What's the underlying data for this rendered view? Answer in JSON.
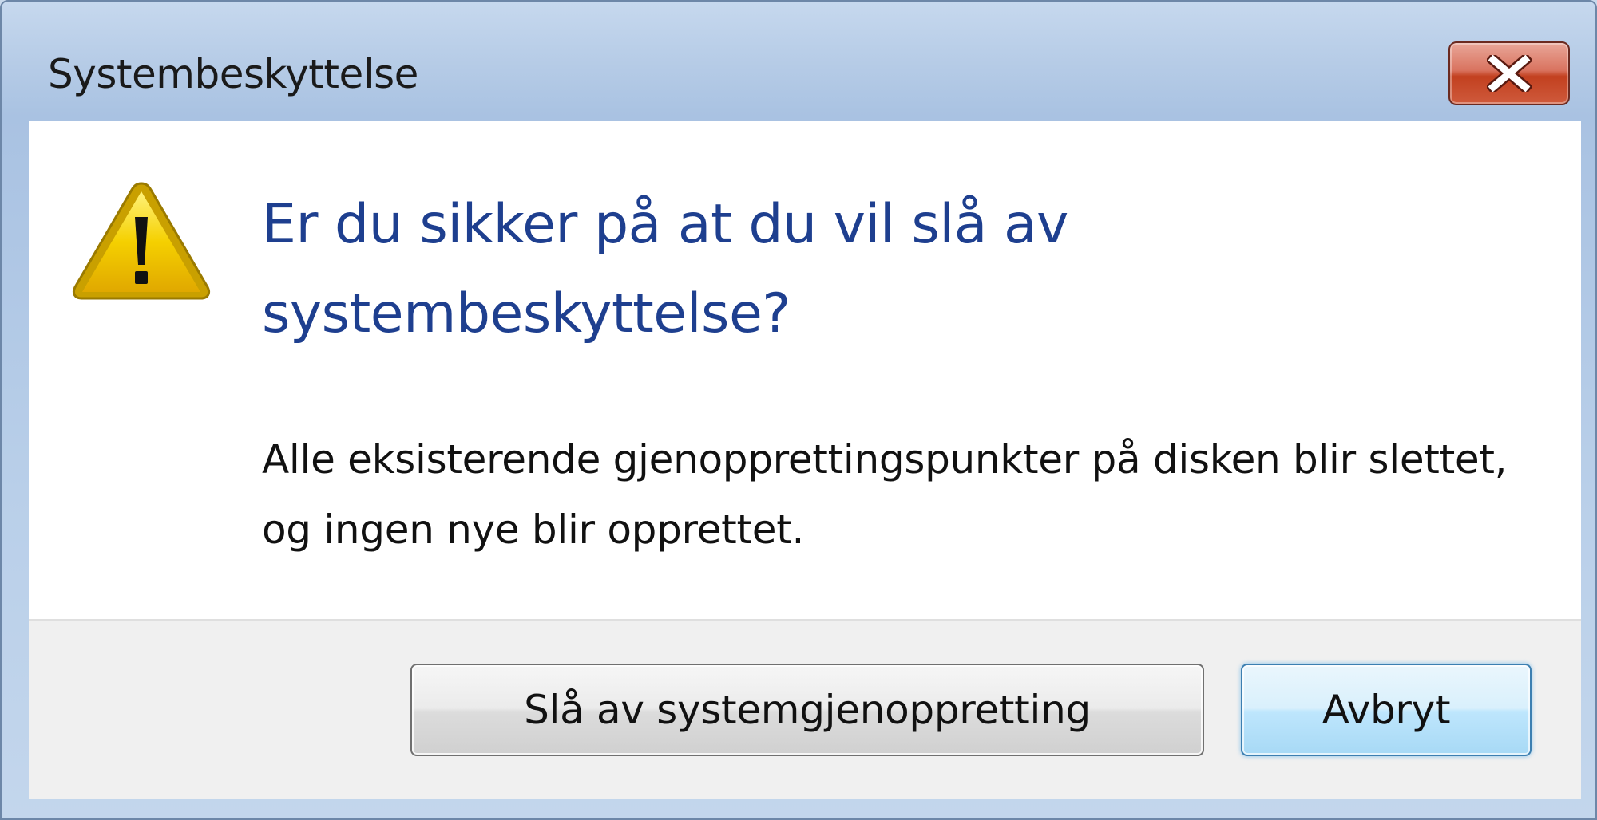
{
  "window": {
    "title": "Systembeskyttelse"
  },
  "titlebar": {
    "close_icon": "close-x-icon"
  },
  "dialog": {
    "icon": "warning-triangle-icon",
    "main_instruction": "Er du sikker på at du vil slå av systembeskyttelse?",
    "content_text": "Alle eksisterende gjenopprettingspunkter på disken blir slettet, og ingen nye blir opprettet."
  },
  "buttons": {
    "turn_off_label": "Slå av systemgjenoppretting",
    "cancel_label": "Avbryt"
  },
  "colors": {
    "main_instruction": "#1e3f8f",
    "close_button": "#c2401f",
    "default_button_border": "#3c7fb1",
    "warning_yellow": "#f5d000"
  }
}
